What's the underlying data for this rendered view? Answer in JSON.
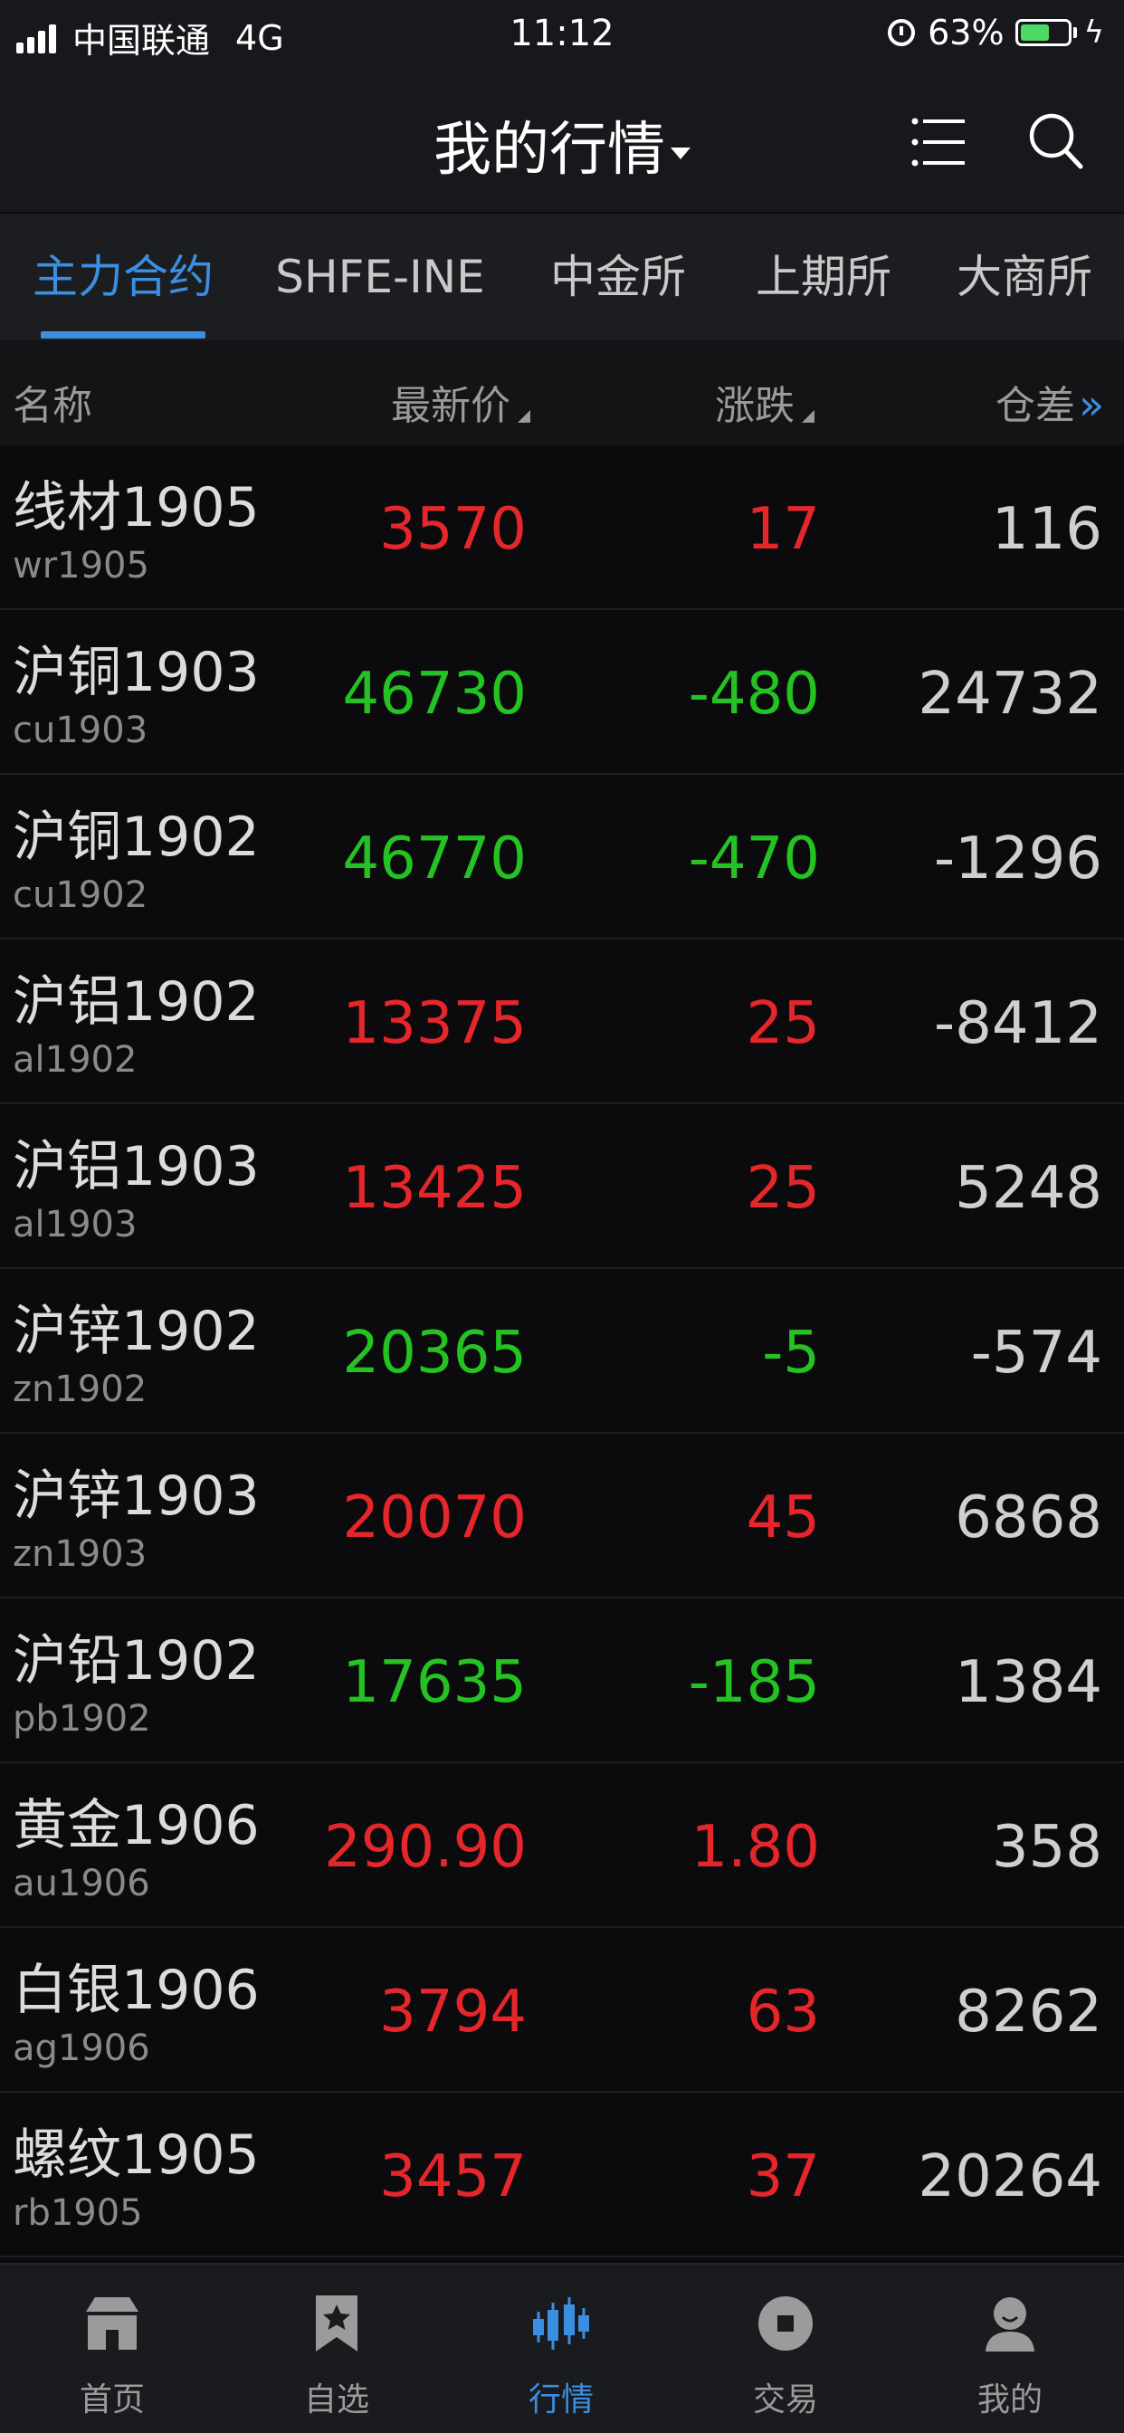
{
  "status_bar": {
    "carrier": "中国联通",
    "network": "4G",
    "time": "11:12",
    "battery_percent": "63%",
    "battery_level": 0.63
  },
  "header": {
    "title": "我的行情"
  },
  "tabs": [
    {
      "label": "主力合约",
      "active": true
    },
    {
      "label": "SHFE-INE",
      "active": false
    },
    {
      "label": "中金所",
      "active": false
    },
    {
      "label": "上期所",
      "active": false
    },
    {
      "label": "大商所",
      "active": false
    }
  ],
  "columns": {
    "name": "名称",
    "price": "最新价",
    "change": "涨跌",
    "diff": "仓差"
  },
  "rows": [
    {
      "name": "线材1905",
      "code": "wr1905",
      "price": "3570",
      "change": "17",
      "diff": "116",
      "dir": "up"
    },
    {
      "name": "沪铜1903",
      "code": "cu1903",
      "price": "46730",
      "change": "-480",
      "diff": "24732",
      "dir": "down"
    },
    {
      "name": "沪铜1902",
      "code": "cu1902",
      "price": "46770",
      "change": "-470",
      "diff": "-1296",
      "dir": "down"
    },
    {
      "name": "沪铝1902",
      "code": "al1902",
      "price": "13375",
      "change": "25",
      "diff": "-8412",
      "dir": "up"
    },
    {
      "name": "沪铝1903",
      "code": "al1903",
      "price": "13425",
      "change": "25",
      "diff": "5248",
      "dir": "up"
    },
    {
      "name": "沪锌1902",
      "code": "zn1902",
      "price": "20365",
      "change": "-5",
      "diff": "-574",
      "dir": "down"
    },
    {
      "name": "沪锌1903",
      "code": "zn1903",
      "price": "20070",
      "change": "45",
      "diff": "6868",
      "dir": "up"
    },
    {
      "name": "沪铅1902",
      "code": "pb1902",
      "price": "17635",
      "change": "-185",
      "diff": "1384",
      "dir": "down"
    },
    {
      "name": "黄金1906",
      "code": "au1906",
      "price": "290.90",
      "change": "1.80",
      "diff": "358",
      "dir": "up"
    },
    {
      "name": "白银1906",
      "code": "ag1906",
      "price": "3794",
      "change": "63",
      "diff": "8262",
      "dir": "up"
    },
    {
      "name": "螺纹1905",
      "code": "rb1905",
      "price": "3457",
      "change": "37",
      "diff": "20264",
      "dir": "up"
    }
  ],
  "bottom_nav": [
    {
      "label": "首页",
      "icon": "home-icon",
      "active": false
    },
    {
      "label": "自选",
      "icon": "bookmark-star-icon",
      "active": false
    },
    {
      "label": "行情",
      "icon": "candlestick-icon",
      "active": true
    },
    {
      "label": "交易",
      "icon": "trade-coin-icon",
      "active": false
    },
    {
      "label": "我的",
      "icon": "profile-icon",
      "active": false
    }
  ],
  "colors": {
    "accent": "#3b8fe0",
    "up": "#e5262b",
    "down": "#25c223",
    "battery": "#4cd964"
  }
}
